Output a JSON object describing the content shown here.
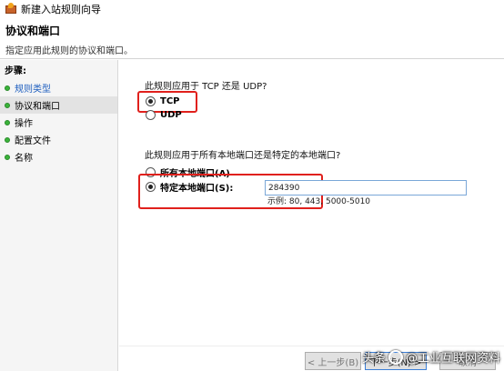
{
  "window": {
    "title": "新建入站规则向导"
  },
  "header": {
    "title": "协议和端口",
    "subtitle": "指定应用此规则的协议和端口。"
  },
  "sidebar": {
    "steps_label": "步骤:",
    "items": [
      {
        "label": "规则类型"
      },
      {
        "label": "协议和端口"
      },
      {
        "label": "操作"
      },
      {
        "label": "配置文件"
      },
      {
        "label": "名称"
      }
    ]
  },
  "protocol": {
    "question": "此规则应用于 TCP 还是 UDP?",
    "options": [
      {
        "label": "TCP",
        "checked": true
      },
      {
        "label": "UDP",
        "checked": false
      }
    ]
  },
  "ports": {
    "question": "此规则应用于所有本地端口还是特定的本地端口?",
    "options": [
      {
        "label": "所有本地端口(A)",
        "checked": false
      },
      {
        "label": "特定本地端口(S):",
        "checked": true
      }
    ],
    "value": "284390",
    "example": "示例: 80, 443, 5000-5010"
  },
  "footer": {
    "back_label": "< 上一步(B)",
    "next_label": "下一步(N) >",
    "cancel_label": "取消"
  },
  "watermark": {
    "text_left": "头条",
    "text_right": "@工业互联网资料"
  },
  "colors": {
    "highlight_box": "#e0201c",
    "active_link": "#1f5fbf",
    "status_dot": "#3ab33a"
  }
}
